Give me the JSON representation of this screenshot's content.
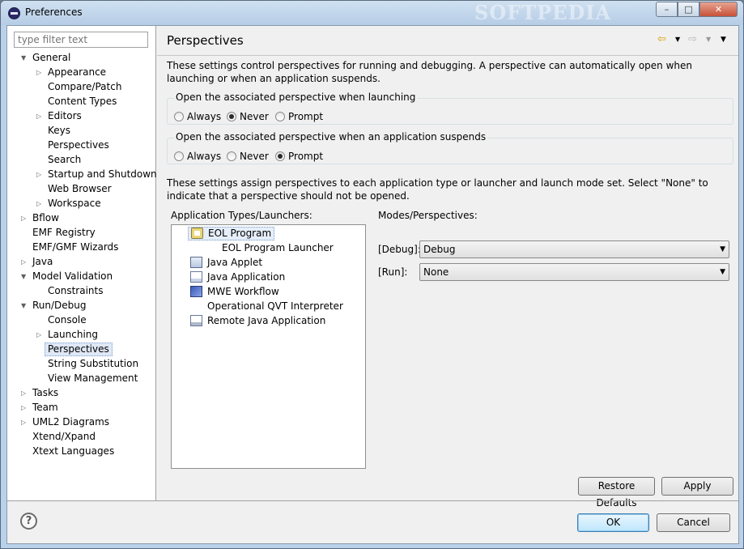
{
  "window": {
    "title": "Preferences",
    "watermark": "SOFTPEDIA",
    "controls": {
      "minimize": "–",
      "maximize": "□",
      "close": "✕"
    }
  },
  "filter": {
    "placeholder": "type filter text"
  },
  "tree": [
    {
      "label": "General",
      "toggle": "▼",
      "depth": 0
    },
    {
      "label": "Appearance",
      "toggle": "▷",
      "depth": 1
    },
    {
      "label": "Compare/Patch",
      "toggle": "",
      "depth": 1
    },
    {
      "label": "Content Types",
      "toggle": "",
      "depth": 1
    },
    {
      "label": "Editors",
      "toggle": "▷",
      "depth": 1
    },
    {
      "label": "Keys",
      "toggle": "",
      "depth": 1
    },
    {
      "label": "Perspectives",
      "toggle": "",
      "depth": 1
    },
    {
      "label": "Search",
      "toggle": "",
      "depth": 1
    },
    {
      "label": "Startup and Shutdown",
      "toggle": "▷",
      "depth": 1
    },
    {
      "label": "Web Browser",
      "toggle": "",
      "depth": 1
    },
    {
      "label": "Workspace",
      "toggle": "▷",
      "depth": 1
    },
    {
      "label": "Bflow",
      "toggle": "▷",
      "depth": 0
    },
    {
      "label": "EMF Registry",
      "toggle": "",
      "depth": 0
    },
    {
      "label": "EMF/GMF Wizards",
      "toggle": "",
      "depth": 0
    },
    {
      "label": "Java",
      "toggle": "▷",
      "depth": 0
    },
    {
      "label": "Model Validation",
      "toggle": "▼",
      "depth": 0
    },
    {
      "label": "Constraints",
      "toggle": "",
      "depth": 1
    },
    {
      "label": "Run/Debug",
      "toggle": "▼",
      "depth": 0
    },
    {
      "label": "Console",
      "toggle": "",
      "depth": 1
    },
    {
      "label": "Launching",
      "toggle": "▷",
      "depth": 1
    },
    {
      "label": "Perspectives",
      "toggle": "",
      "depth": 1,
      "selected": true
    },
    {
      "label": "String Substitution",
      "toggle": "",
      "depth": 1
    },
    {
      "label": "View Management",
      "toggle": "",
      "depth": 1
    },
    {
      "label": "Tasks",
      "toggle": "▷",
      "depth": 0
    },
    {
      "label": "Team",
      "toggle": "▷",
      "depth": 0
    },
    {
      "label": "UML2 Diagrams",
      "toggle": "▷",
      "depth": 0
    },
    {
      "label": "Xtend/Xpand",
      "toggle": "",
      "depth": 0
    },
    {
      "label": "Xtext Languages",
      "toggle": "",
      "depth": 0
    }
  ],
  "page": {
    "title": "Perspectives",
    "nav": {
      "back": "⇦",
      "back_menu": "▼",
      "forward": "⇨",
      "forward_menu": "▼",
      "view_menu": "▼"
    },
    "intro": "These settings control perspectives for running and debugging. A perspective can automatically open when launching or when an application suspends.",
    "launch_group": {
      "label": "Open the associated perspective when launching",
      "options": [
        "Always",
        "Never",
        "Prompt"
      ],
      "selected": "Never"
    },
    "suspend_group": {
      "label": "Open the associated perspective when an application suspends",
      "options": [
        "Always",
        "Never",
        "Prompt"
      ],
      "selected": "Prompt"
    },
    "assign_text": "These settings assign perspectives to each application type or launcher and launch mode set. Select \"None\" to indicate that a perspective should not be opened.",
    "types_label": "Application Types/Launchers:",
    "modes_label": "Modes/Perspectives:",
    "types": [
      {
        "label": "EOL Program",
        "icon": "eol-program-icon",
        "selected": true,
        "indent": false
      },
      {
        "label": "EOL Program Launcher",
        "icon": "",
        "selected": false,
        "indent": true
      },
      {
        "label": "Java Applet",
        "icon": "java-applet-icon",
        "selected": false,
        "indent": false
      },
      {
        "label": "Java Application",
        "icon": "java-application-icon",
        "selected": false,
        "indent": false
      },
      {
        "label": "MWE Workflow",
        "icon": "mwe-workflow-icon",
        "selected": false,
        "indent": false
      },
      {
        "label": "Operational QVT Interpreter",
        "icon": "",
        "selected": false,
        "indent": false
      },
      {
        "label": "Remote Java Application",
        "icon": "remote-java-icon",
        "selected": false,
        "indent": false
      }
    ],
    "modes": [
      {
        "label": "[Debug]:",
        "value": "Debug"
      },
      {
        "label": "[Run]:",
        "value": "None"
      }
    ],
    "restore_defaults": "Restore Defaults",
    "apply": "Apply"
  },
  "footer": {
    "help": "?",
    "ok": "OK",
    "cancel": "Cancel"
  },
  "colors": {
    "selection": "#dfe8f6",
    "title_bar": "#b9d1ea",
    "default_button": "#bee6fd"
  }
}
